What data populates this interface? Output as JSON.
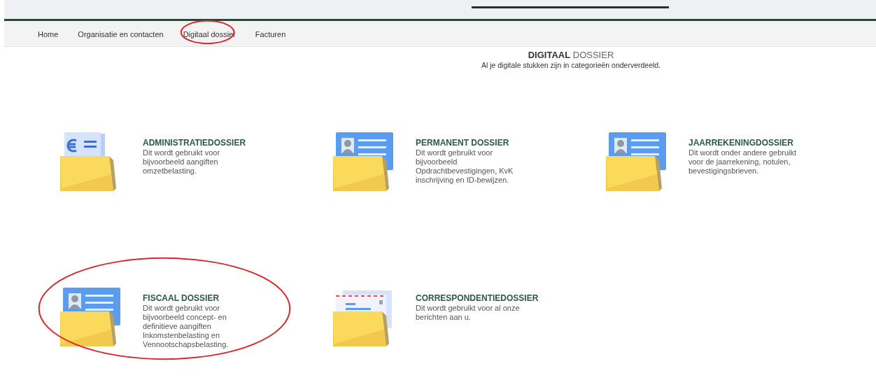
{
  "nav": [
    {
      "label": "Home",
      "circled": false
    },
    {
      "label": "Organisatie en contacten",
      "circled": false
    },
    {
      "label": "Digitaal dossier",
      "circled": true
    },
    {
      "label": "Facturen",
      "circled": false
    }
  ],
  "header": {
    "title_bold": "DIGITAAL",
    "title_rest": "DOSSIER",
    "subtitle": "Al je digitale stukken zijn in categorieën onderverdeeld."
  },
  "dossiers": [
    {
      "kind": "euro",
      "title": "ADMINISTRATIEDOSSIER",
      "circled": false,
      "description": [
        "Dit wordt gebruikt voor",
        "bijvoorbeeld aangiften",
        "omzetbelasting."
      ]
    },
    {
      "kind": "id-card",
      "title": "PERMANENT DOSSIER",
      "circled": false,
      "description": [
        "Dit wordt gebruikt voor",
        "bijvoorbeeld",
        "Opdrachtbevestigingen, KvK",
        "inschrijving en ID-bewijzen."
      ]
    },
    {
      "kind": "id-card",
      "title": "JAARREKENINGDOSSIER",
      "circled": false,
      "description": [
        "Dit wordt onder andere gebruikt",
        "voor de jaarrekening, notulen,",
        "bevestigingsbrieven."
      ]
    },
    {
      "kind": "id-card",
      "title": "FISCAAL DOSSIER",
      "circled": true,
      "description": [
        "Dit wordt gebruikt voor",
        "bijvoorbeeld concept- en",
        "definitieve aangiften",
        "Inkomstenbelasting en",
        "Vennootschapsbelasting."
      ]
    },
    {
      "kind": "envelope",
      "title": "CORRESPONDENTIEDOSSIER",
      "circled": false,
      "description": [
        "Dit wordt gebruikt voor al onze",
        "berichten aan u."
      ]
    }
  ]
}
